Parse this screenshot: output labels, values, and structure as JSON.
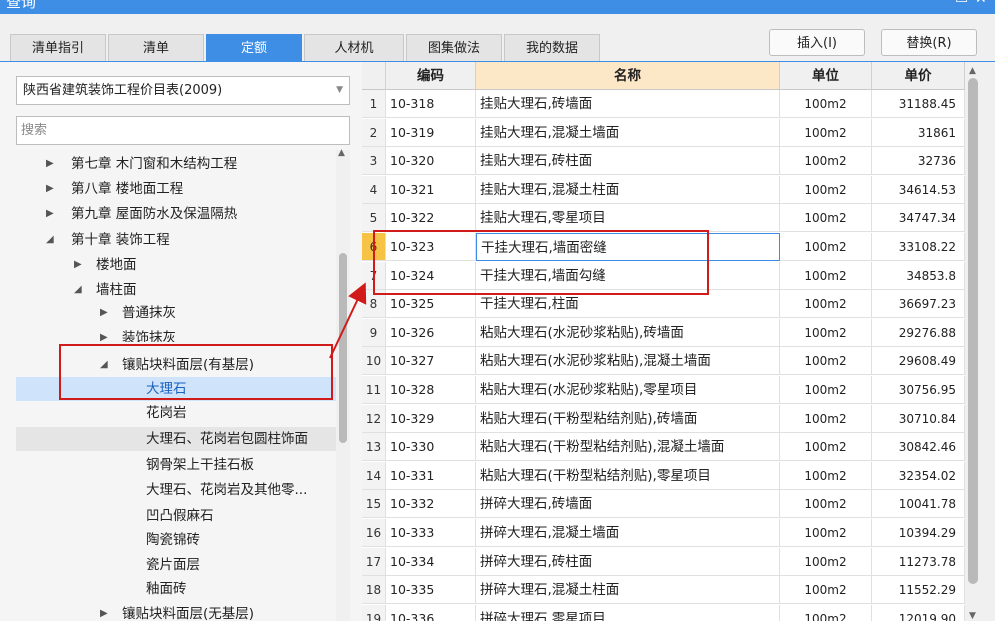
{
  "window": {
    "title": "查询",
    "minimize_glyph": "▭",
    "close_glyph": "✕"
  },
  "tabs": [
    {
      "label": "清单指引"
    },
    {
      "label": "清单"
    },
    {
      "label": "定额"
    },
    {
      "label": "人材机"
    },
    {
      "label": "图集做法"
    },
    {
      "label": "我的数据"
    }
  ],
  "active_tab": "定额",
  "buttons": {
    "insert": "插入(I)",
    "replace": "替换(R)"
  },
  "library_select": {
    "value": "陕西省建筑装饰工程价目表(2009)"
  },
  "search": {
    "placeholder": "搜索"
  },
  "tree": [
    {
      "label": "第七章 木门窗和木结构工程",
      "state": "collapsed"
    },
    {
      "label": "第八章 楼地面工程",
      "state": "collapsed"
    },
    {
      "label": "第九章 屋面防水及保温隔热",
      "state": "collapsed"
    },
    {
      "label": "第十章 装饰工程",
      "state": "expanded"
    },
    {
      "label": "楼地面",
      "state": "collapsed"
    },
    {
      "label": "墙柱面",
      "state": "expanded"
    },
    {
      "label": "普通抹灰",
      "state": "collapsed"
    },
    {
      "label": "装饰抹灰",
      "state": "collapsed"
    },
    {
      "label": "镶贴块料面层(有基层)",
      "state": "expanded"
    },
    {
      "label": "大理石",
      "state": "selected"
    },
    {
      "label": "花岗岩",
      "state": "leaf"
    },
    {
      "label": "大理石、花岗岩包圆柱饰面",
      "state": "hover"
    },
    {
      "label": "钢骨架上干挂石板",
      "state": "leaf"
    },
    {
      "label": "大理石、花岗岩及其他零...",
      "state": "leaf"
    },
    {
      "label": "凹凸假麻石",
      "state": "leaf"
    },
    {
      "label": "陶瓷锦砖",
      "state": "leaf"
    },
    {
      "label": "瓷片面层",
      "state": "leaf"
    },
    {
      "label": "釉面砖",
      "state": "leaf"
    },
    {
      "label": "镶贴块料面层(无基层)",
      "state": "collapsed"
    }
  ],
  "table": {
    "headers": {
      "code": "编码",
      "name": "名称",
      "unit": "单位",
      "price": "单价"
    },
    "current_row": 6,
    "rows": [
      {
        "num": "1",
        "code": "10-318",
        "name": "挂贴大理石,砖墙面",
        "unit": "100m2",
        "price": "31188.45"
      },
      {
        "num": "2",
        "code": "10-319",
        "name": "挂贴大理石,混凝土墙面",
        "unit": "100m2",
        "price": "31861"
      },
      {
        "num": "3",
        "code": "10-320",
        "name": "挂贴大理石,砖柱面",
        "unit": "100m2",
        "price": "32736"
      },
      {
        "num": "4",
        "code": "10-321",
        "name": "挂贴大理石,混凝土柱面",
        "unit": "100m2",
        "price": "34614.53"
      },
      {
        "num": "5",
        "code": "10-322",
        "name": "挂贴大理石,零星项目",
        "unit": "100m2",
        "price": "34747.34"
      },
      {
        "num": "6",
        "code": "10-323",
        "name": "干挂大理石,墙面密缝",
        "unit": "100m2",
        "price": "33108.22"
      },
      {
        "num": "7",
        "code": "10-324",
        "name": "干挂大理石,墙面勾缝",
        "unit": "100m2",
        "price": "34853.8"
      },
      {
        "num": "8",
        "code": "10-325",
        "name": "干挂大理石,柱面",
        "unit": "100m2",
        "price": "36697.23"
      },
      {
        "num": "9",
        "code": "10-326",
        "name": "粘贴大理石(水泥砂浆粘贴),砖墙面",
        "unit": "100m2",
        "price": "29276.88"
      },
      {
        "num": "10",
        "code": "10-327",
        "name": "粘贴大理石(水泥砂浆粘贴),混凝土墙面",
        "unit": "100m2",
        "price": "29608.49"
      },
      {
        "num": "11",
        "code": "10-328",
        "name": "粘贴大理石(水泥砂浆粘贴),零星项目",
        "unit": "100m2",
        "price": "30756.95"
      },
      {
        "num": "12",
        "code": "10-329",
        "name": "粘贴大理石(干粉型粘结剂贴),砖墙面",
        "unit": "100m2",
        "price": "30710.84"
      },
      {
        "num": "13",
        "code": "10-330",
        "name": "粘贴大理石(干粉型粘结剂贴),混凝土墙面",
        "unit": "100m2",
        "price": "30842.46"
      },
      {
        "num": "14",
        "code": "10-331",
        "name": "粘贴大理石(干粉型粘结剂贴),零星项目",
        "unit": "100m2",
        "price": "32354.02"
      },
      {
        "num": "15",
        "code": "10-332",
        "name": "拼碎大理石,砖墙面",
        "unit": "100m2",
        "price": "10041.78"
      },
      {
        "num": "16",
        "code": "10-333",
        "name": "拼碎大理石,混凝土墙面",
        "unit": "100m2",
        "price": "10394.29"
      },
      {
        "num": "17",
        "code": "10-334",
        "name": "拼碎大理石,砖柱面",
        "unit": "100m2",
        "price": "11273.78"
      },
      {
        "num": "18",
        "code": "10-335",
        "name": "拼碎大理石,混凝土柱面",
        "unit": "100m2",
        "price": "11552.29"
      },
      {
        "num": "19",
        "code": "10-336",
        "name": "拼碎大理石,零星项目",
        "unit": "100m2",
        "price": "12019.90"
      }
    ]
  },
  "colors": {
    "accent": "#3d8ee4",
    "annotation": "#d11a1a",
    "current_row_marker": "#f6c344",
    "header_highlight": "#fce7c7"
  }
}
